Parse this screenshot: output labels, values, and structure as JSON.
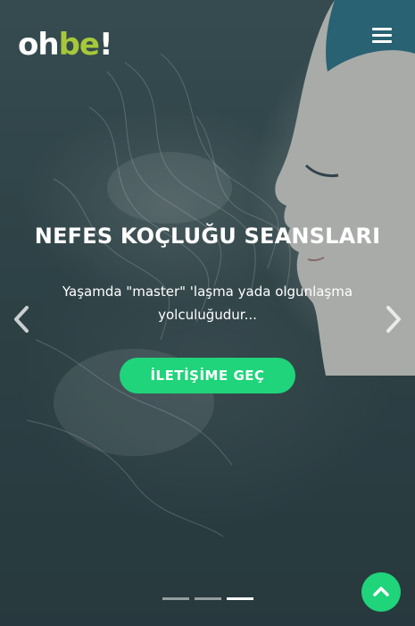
{
  "header": {
    "logo_part1": "oh",
    "logo_part2": "be",
    "logo_part3": "!",
    "menu_icon": "hamburger-menu-icon"
  },
  "slide": {
    "title": "NEFES KOÇLUĞU SEANSLARI",
    "subtitle": "Yaşamda \"master\" 'laşma yada olgunlaşma yolculuğudur...",
    "cta_label": "İLETİŞİME GEÇ"
  },
  "carousel": {
    "prev_icon": "chevron-left-icon",
    "next_icon": "chevron-right-icon",
    "slide_count": 3,
    "active_index": 2
  },
  "scroll_top_icon": "chevron-up-icon",
  "colors": {
    "accent": "#1fd47a",
    "logo_green": "#a6c83a",
    "text": "#ffffff"
  }
}
